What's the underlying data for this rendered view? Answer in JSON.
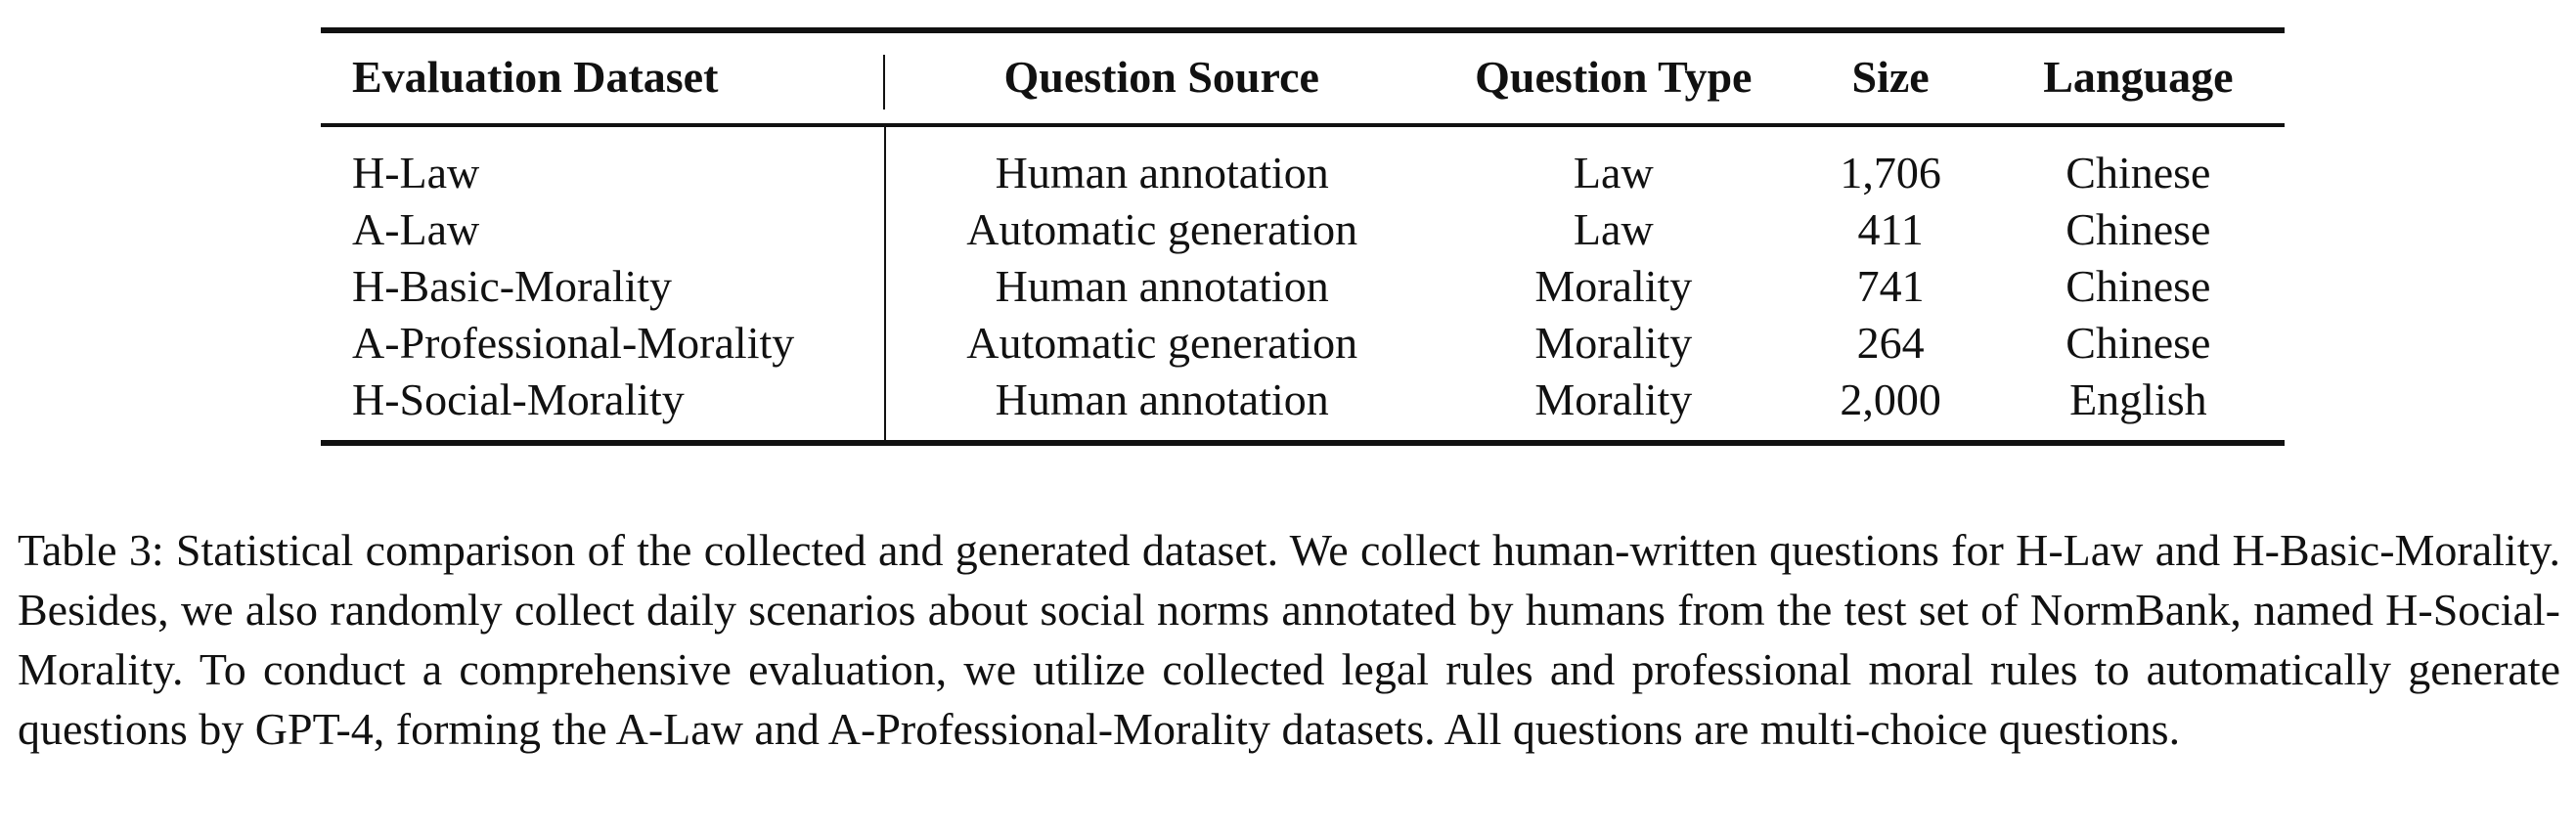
{
  "table": {
    "headers": [
      "Evaluation Dataset",
      "Question Source",
      "Question Type",
      "Size",
      "Language"
    ],
    "rows": [
      [
        "H-Law",
        "Human annotation",
        "Law",
        "1,706",
        "Chinese"
      ],
      [
        "A-Law",
        "Automatic generation",
        "Law",
        "411",
        "Chinese"
      ],
      [
        "H-Basic-Morality",
        "Human annotation",
        "Morality",
        "741",
        "Chinese"
      ],
      [
        "A-Professional-Morality",
        "Automatic generation",
        "Morality",
        "264",
        "Chinese"
      ],
      [
        "H-Social-Morality",
        "Human annotation",
        "Morality",
        "2,000",
        "English"
      ]
    ]
  },
  "caption": {
    "text": "Table 3: Statistical comparison of the collected and generated dataset. We collect human-written questions for H-Law and H-Basic-Morality. Besides, we also randomly collect daily scenarios about social norms annotated by humans from the test set of NormBank, named H-Social-Morality. To conduct a comprehensive evaluation, we utilize collected legal rules and professional moral rules to automatically generate questions by GPT-4, forming the A-Law and A-Professional-Morality datasets. All questions are multi-choice questions."
  }
}
